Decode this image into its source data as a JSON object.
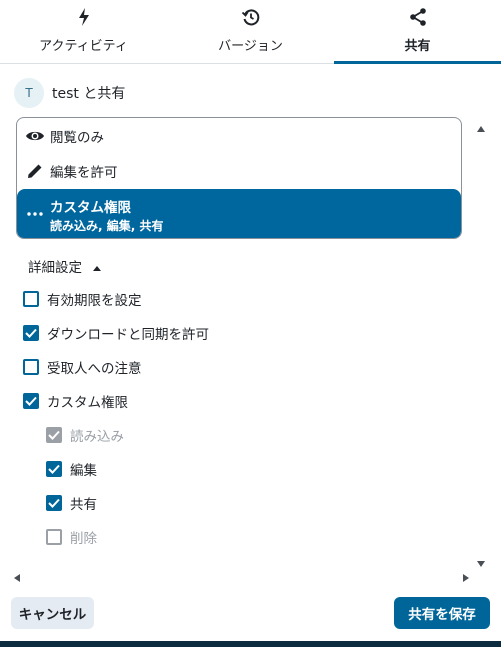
{
  "tabs": [
    {
      "label": "アクティビティ",
      "icon": "lightning-icon",
      "active": false
    },
    {
      "label": "バージョン",
      "icon": "history-icon",
      "active": false
    },
    {
      "label": "共有",
      "icon": "share-icon",
      "active": true
    }
  ],
  "share_with": {
    "avatar_initial": "T",
    "text": "test と共有"
  },
  "permission_options": [
    {
      "label": "閲覧のみ",
      "icon": "eye-icon"
    },
    {
      "label": "編集を許可",
      "icon": "pencil-icon"
    },
    {
      "label": "カスタム権限",
      "sublabel": "読み込み, 編集, 共有",
      "icon": "more-horizontal-icon",
      "selected": true
    }
  ],
  "advanced": {
    "label": "詳細設定",
    "expanded": true
  },
  "checkboxes": [
    {
      "label": "有効期限を設定",
      "checked": false,
      "disabled": false
    },
    {
      "label": "ダウンロードと同期を許可",
      "checked": true,
      "disabled": false
    },
    {
      "label": "受取人への注意",
      "checked": false,
      "disabled": false
    },
    {
      "label": "カスタム権限",
      "checked": true,
      "disabled": false
    }
  ],
  "custom_permissions": [
    {
      "label": "読み込み",
      "checked": true,
      "disabled": true
    },
    {
      "label": "編集",
      "checked": true,
      "disabled": false
    },
    {
      "label": "共有",
      "checked": true,
      "disabled": false
    },
    {
      "label": "削除",
      "checked": false,
      "disabled": true
    }
  ],
  "footer": {
    "cancel_label": "キャンセル",
    "save_label": "共有を保存"
  },
  "colors": {
    "accent": "#006699",
    "disabled": "#9aa0a6",
    "cancel_bg": "#e4ebf2"
  }
}
